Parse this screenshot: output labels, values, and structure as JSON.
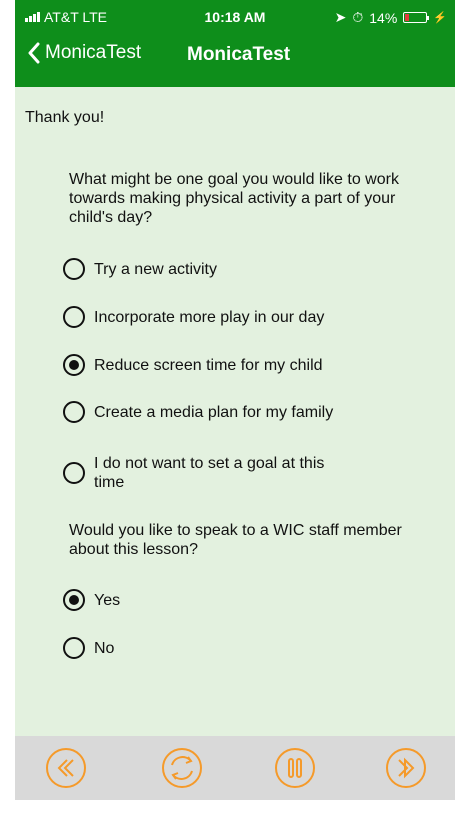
{
  "status_bar": {
    "carrier": "AT&T  LTE",
    "time": "10:18 AM",
    "battery": "14%"
  },
  "nav": {
    "back_label": "MonicaTest",
    "title": "MonicaTest"
  },
  "content": {
    "thank_you": "Thank you!",
    "question1": {
      "text": "What might be one goal you would like to work towards making physical activity a part of your child's day?",
      "options": [
        {
          "label": "Try a new activity",
          "selected": false
        },
        {
          "label": "Incorporate more play in our day",
          "selected": false
        },
        {
          "label": "Reduce screen time for my child",
          "selected": true
        },
        {
          "label": "Create a media plan for my family",
          "selected": false
        },
        {
          "label": "I do not want to set a goal at this time",
          "selected": false
        }
      ]
    },
    "question2": {
      "text": "Would you like to speak to a WIC staff member about this lesson?",
      "options": [
        {
          "label": "Yes",
          "selected": true
        },
        {
          "label": "No",
          "selected": false
        }
      ]
    }
  },
  "controls": [
    "rewind-icon",
    "replay-icon",
    "pause-icon",
    "forward-icon"
  ],
  "colors": {
    "nav_green": "#0e8e1b",
    "background": "#e3f1df",
    "control_orange": "#f59a2a",
    "battery_low": "#e23b3b"
  }
}
